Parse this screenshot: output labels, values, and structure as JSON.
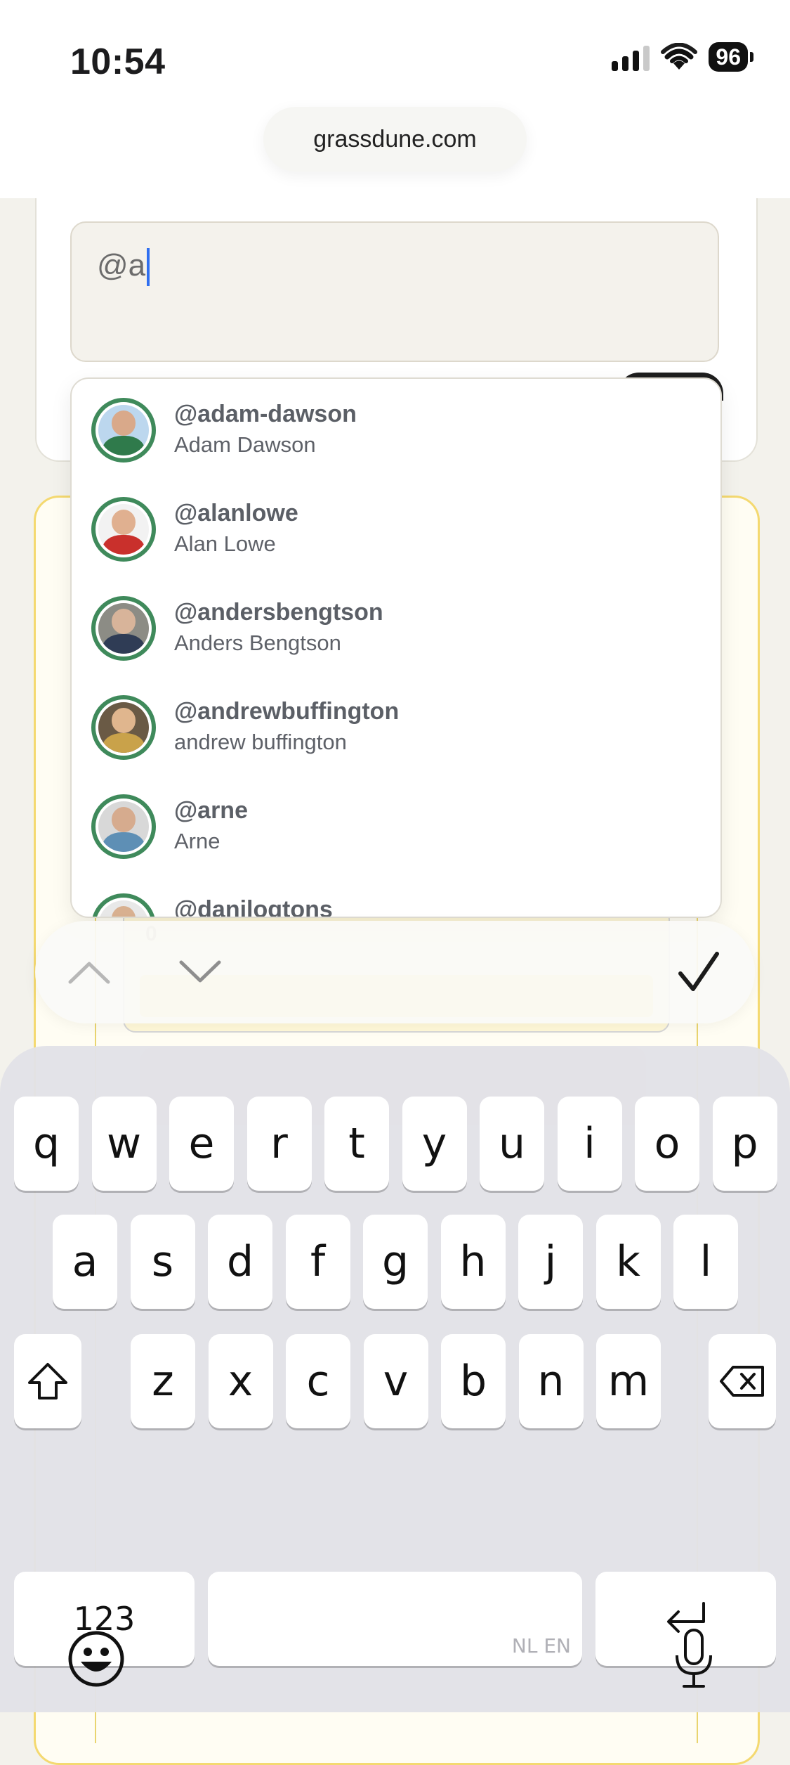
{
  "status_bar": {
    "time": "10:54",
    "battery": "96"
  },
  "browser": {
    "url": "grassdune.com"
  },
  "composer": {
    "value": "@a"
  },
  "suggestions": [
    {
      "handle": "@adam-dawson",
      "name": "Adam Dawson",
      "colors": {
        "bg": "#bcd7ee",
        "head": "#d9a98a",
        "shirt": "#2f7a4b"
      }
    },
    {
      "handle": "@alanlowe",
      "name": "Alan Lowe",
      "colors": {
        "bg": "#f2f2f2",
        "head": "#e0b090",
        "shirt": "#c9302c"
      }
    },
    {
      "handle": "@andersbengtson",
      "name": "Anders Bengtson",
      "colors": {
        "bg": "#8c8c85",
        "head": "#d8b49a",
        "shirt": "#2f3c55"
      }
    },
    {
      "handle": "@andrewbuffington",
      "name": "andrew buffington",
      "colors": {
        "bg": "#6a5a45",
        "head": "#e0b68e",
        "shirt": "#c9a24a"
      }
    },
    {
      "handle": "@arne",
      "name": "Arne",
      "colors": {
        "bg": "#d8d8d8",
        "head": "#d6ab8e",
        "shirt": "#5e8fb5"
      }
    },
    {
      "handle": "@danilogtons",
      "name": "",
      "colors": {
        "bg": "#e8e8e8",
        "head": "#d8b090",
        "shirt": "#5b6b7b"
      }
    }
  ],
  "background_card": {
    "left_label": "0",
    "right_label": ""
  },
  "accessory_bar": {
    "up_icon": "chevron-up-icon",
    "down_icon": "chevron-down-icon",
    "done_icon": "checkmark-icon"
  },
  "keyboard": {
    "row1": [
      "q",
      "w",
      "e",
      "r",
      "t",
      "y",
      "u",
      "i",
      "o",
      "p"
    ],
    "row2": [
      "a",
      "s",
      "d",
      "f",
      "g",
      "h",
      "j",
      "k",
      "l"
    ],
    "row3": [
      "z",
      "x",
      "c",
      "v",
      "b",
      "n",
      "m"
    ],
    "numbers_label": "123",
    "space_hint": "NL EN"
  }
}
